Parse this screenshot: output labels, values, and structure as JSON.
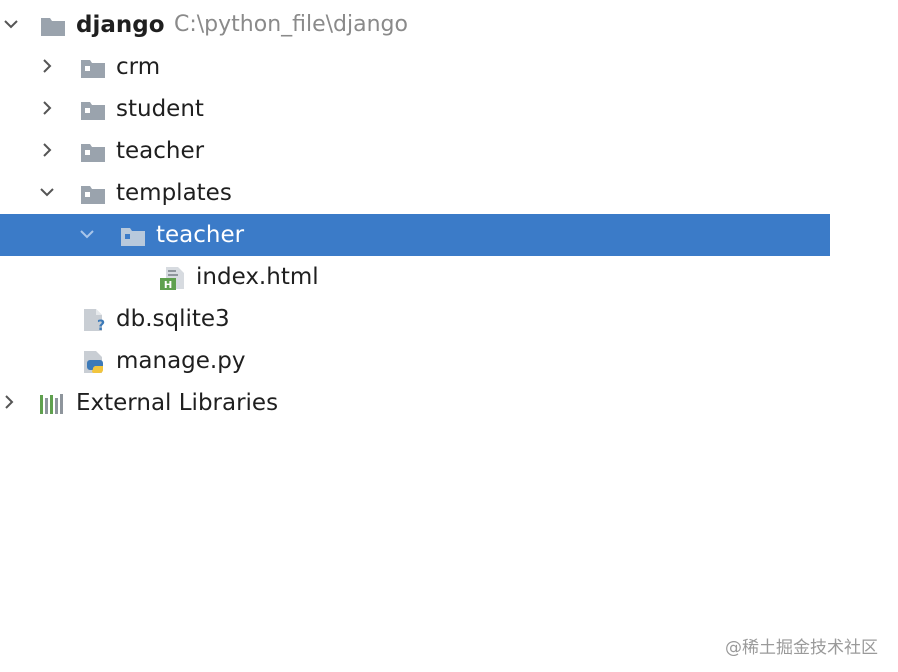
{
  "tree": {
    "root": {
      "label": "django",
      "path": "C:\\python_file\\django"
    },
    "items": [
      {
        "label": "crm"
      },
      {
        "label": "student"
      },
      {
        "label": "teacher"
      },
      {
        "label": "templates"
      },
      {
        "label": "teacher"
      },
      {
        "label": "index.html"
      },
      {
        "label": "db.sqlite3"
      },
      {
        "label": "manage.py"
      }
    ],
    "external": {
      "label": "External Libraries"
    }
  },
  "colors": {
    "selection": "#3b7bc8",
    "folder": "#9aa3ad",
    "html_badge": "#5fa04e",
    "python_blue": "#3d7ab8",
    "python_yellow": "#f2c53d"
  },
  "watermark": "@稀土掘金技术社区"
}
